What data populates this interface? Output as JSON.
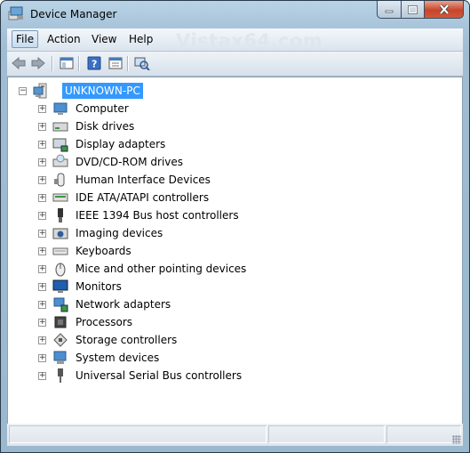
{
  "window": {
    "title": "Device Manager"
  },
  "menu": {
    "items": [
      "File",
      "Action",
      "View",
      "Help"
    ],
    "watermark": "Vistax64.com"
  },
  "toolbar": {
    "buttons": [
      "back-icon",
      "forward-icon",
      "show-hide-console-tree-icon",
      "help-icon",
      "properties-icon",
      "scan-hardware-changes-icon"
    ]
  },
  "tree": {
    "root": "UNKNOWN-PC",
    "items": [
      {
        "label": "Computer",
        "icon": "computer-icon"
      },
      {
        "label": "Disk drives",
        "icon": "disk-drive-icon"
      },
      {
        "label": "Display adapters",
        "icon": "display-adapter-icon"
      },
      {
        "label": "DVD/CD-ROM drives",
        "icon": "dvd-drive-icon"
      },
      {
        "label": "Human Interface Devices",
        "icon": "hid-icon"
      },
      {
        "label": "IDE ATA/ATAPI controllers",
        "icon": "ide-controller-icon"
      },
      {
        "label": "IEEE 1394 Bus host controllers",
        "icon": "firewire-icon"
      },
      {
        "label": "Imaging devices",
        "icon": "camera-icon"
      },
      {
        "label": "Keyboards",
        "icon": "keyboard-icon"
      },
      {
        "label": "Mice and other pointing devices",
        "icon": "mouse-icon"
      },
      {
        "label": "Monitors",
        "icon": "monitor-icon"
      },
      {
        "label": "Network adapters",
        "icon": "network-adapter-icon"
      },
      {
        "label": "Processors",
        "icon": "processor-icon"
      },
      {
        "label": "Storage controllers",
        "icon": "storage-controller-icon"
      },
      {
        "label": "System devices",
        "icon": "system-devices-icon"
      },
      {
        "label": "Universal Serial Bus controllers",
        "icon": "usb-icon"
      }
    ]
  },
  "colors": {
    "selection": "#3399ff",
    "close_button": "#c8452a"
  }
}
